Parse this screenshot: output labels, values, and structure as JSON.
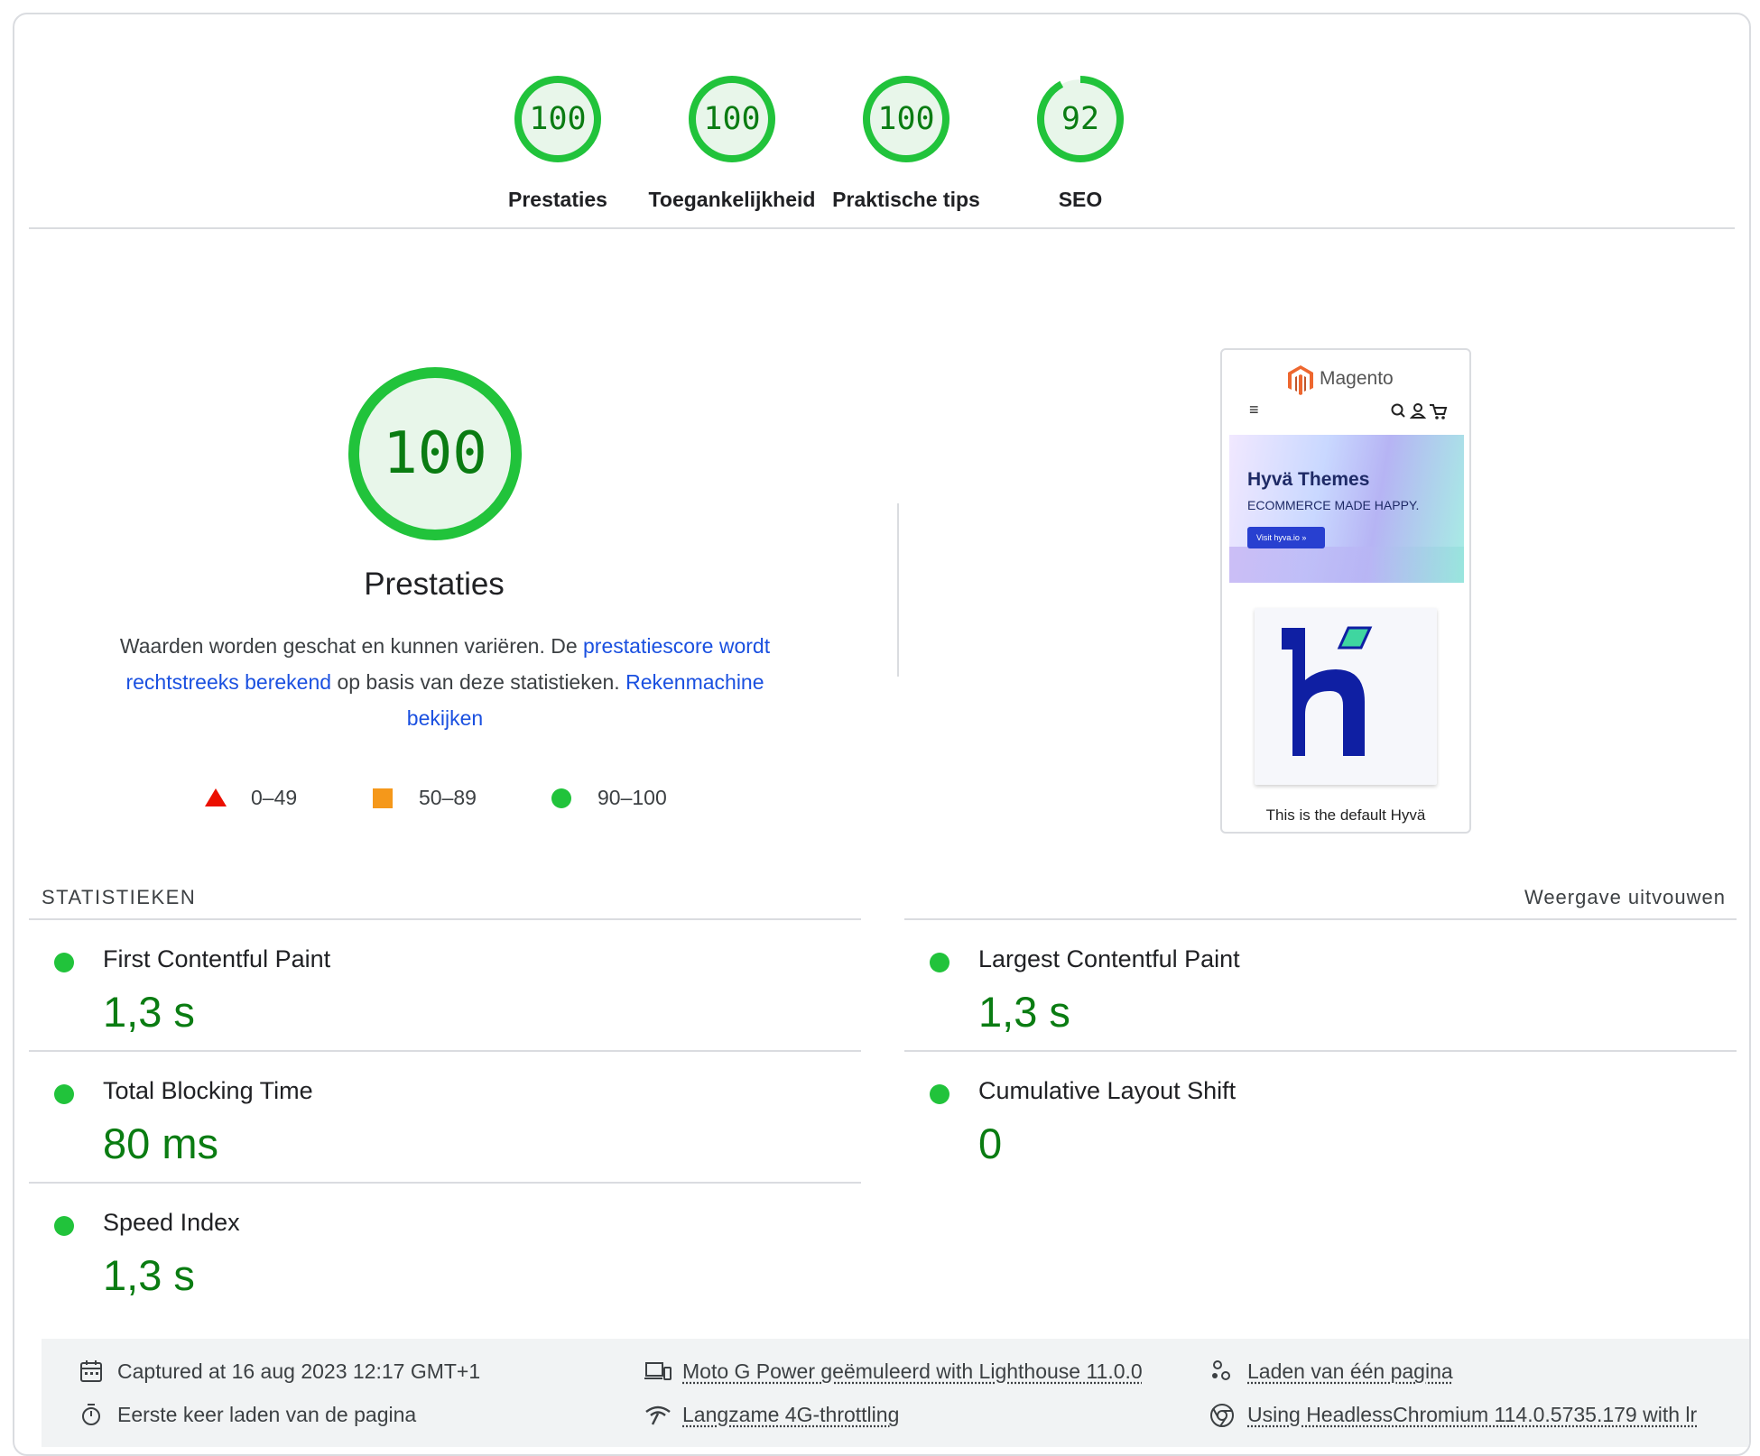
{
  "categories": [
    {
      "label": "Prestaties",
      "score": "100",
      "fraction": 1.0
    },
    {
      "label": "Toegankelijkheid",
      "score": "100",
      "fraction": 1.0
    },
    {
      "label": "Praktische tips",
      "score": "100",
      "fraction": 1.0
    },
    {
      "label": "SEO",
      "score": "92",
      "fraction": 0.92
    }
  ],
  "main": {
    "score": "100",
    "title": "Prestaties",
    "desc_1": "Waarden worden geschat en kunnen variëren. De ",
    "desc_link_1": "prestatiescore wordt rechtstreeks berekend",
    "desc_2": " op basis van deze statistieken. ",
    "desc_link_2": "Rekenmachine bekijken"
  },
  "legend": {
    "fail": "0–49",
    "average": "50–89",
    "pass": "90–100"
  },
  "preview": {
    "logo_text": "Magento",
    "menu_icon": "≡",
    "banner_title": "Hyvä Themes",
    "banner_subtitle": "ECOMMERCE MADE HAPPY.",
    "banner_button": "Visit hyva.io »",
    "caption": "This is the default Hyvä"
  },
  "metrics": {
    "title": "STATISTIEKEN",
    "expand": "Weergave uitvouwen",
    "items": [
      {
        "name": "First Contentful Paint",
        "value": "1,3 s"
      },
      {
        "name": "Largest Contentful Paint",
        "value": "1,3 s"
      },
      {
        "name": "Total Blocking Time",
        "value": "80 ms"
      },
      {
        "name": "Cumulative Layout Shift",
        "value": "0"
      },
      {
        "name": "Speed Index",
        "value": "1,3 s"
      }
    ]
  },
  "footer": {
    "captured": "Captured at 16 aug 2023 12:17 GMT+1",
    "device": "Moto G Power geëmuleerd with Lighthouse 11.0.0",
    "session": "Laden van één pagina",
    "first_load": "Eerste keer laden van de pagina",
    "throttling": "Langzame 4G-throttling",
    "browser": "Using HeadlessChromium 114.0.5735.179 with lr"
  },
  "colors": {
    "pass": "#0a7c12",
    "pass_ring": "#21c33b",
    "pass_fill": "#e8f6ea",
    "fail": "#eb0f00",
    "average": "#f5981a",
    "link": "#1a50e0"
  }
}
